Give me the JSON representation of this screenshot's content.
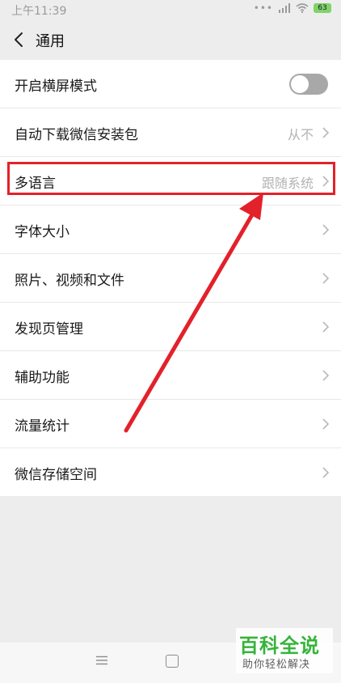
{
  "status_bar": {
    "time": "上午11:39",
    "dots": "•••",
    "battery": "63"
  },
  "header": {
    "title": "通用"
  },
  "settings": [
    {
      "label": "开启横屏模式",
      "type": "toggle",
      "value": "",
      "toggle_on": false
    },
    {
      "label": "自动下载微信安装包",
      "type": "chevron",
      "value": "从不"
    },
    {
      "label": "多语言",
      "type": "chevron",
      "value": "跟随系统"
    },
    {
      "label": "字体大小",
      "type": "chevron",
      "value": ""
    },
    {
      "label": "照片、视频和文件",
      "type": "chevron",
      "value": ""
    },
    {
      "label": "发现页管理",
      "type": "chevron",
      "value": ""
    },
    {
      "label": "辅助功能",
      "type": "chevron",
      "value": ""
    },
    {
      "label": "流量统计",
      "type": "chevron",
      "value": ""
    },
    {
      "label": "微信存储空间",
      "type": "chevron",
      "value": ""
    }
  ],
  "annotation": {
    "color": "#e3212a"
  },
  "watermark": {
    "title": "百科全说",
    "subtitle": "助你轻松解决"
  }
}
